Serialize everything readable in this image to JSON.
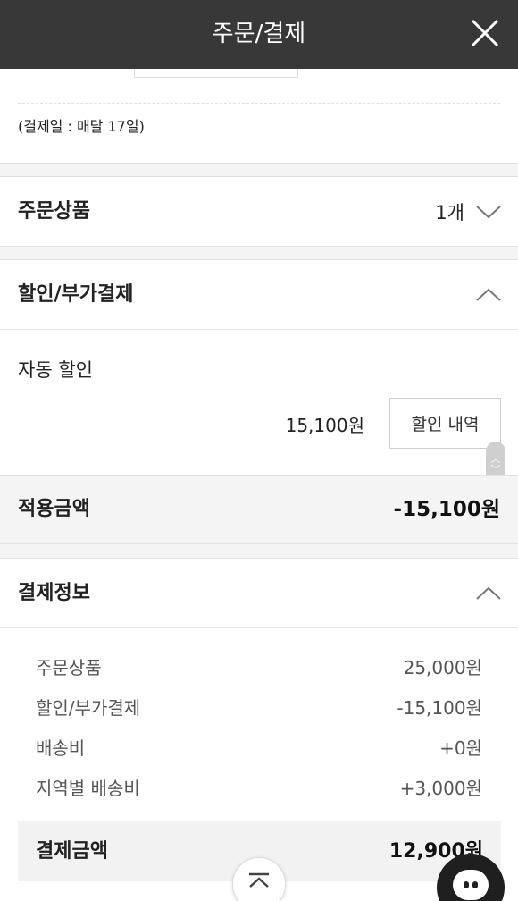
{
  "header": {
    "title": "주문/결제",
    "close_icon": "close-icon"
  },
  "payment_date": {
    "text": "(결제일 : 매달 17일)"
  },
  "order_items": {
    "title": "주문상품",
    "count": "1개",
    "toggle_icon": "chevron-down-icon"
  },
  "discount": {
    "title": "할인/부가결제",
    "toggle_icon": "chevron-up-icon",
    "auto_label": "자동 할인",
    "auto_amount": "15,100원",
    "detail_button": "할인 내역"
  },
  "applied": {
    "label": "적용금액",
    "value": "-15,100원"
  },
  "payment_info": {
    "title": "결제정보",
    "toggle_icon": "chevron-up-icon",
    "rows": [
      {
        "label": "주문상품",
        "value": "25,000원"
      },
      {
        "label": "할인/부가결제",
        "value": "-15,100원"
      },
      {
        "label": "배송비",
        "value": "+0원"
      },
      {
        "label": "지역별 배송비",
        "value": "+3,000원"
      }
    ],
    "total_label": "결제금액",
    "total_value": "12,900원"
  },
  "floating": {
    "scroll_top_icon": "arrow-up-icon",
    "chat_icon": "chat-icon"
  },
  "colors": {
    "header_bg": "#383838",
    "section_gap": "#f4f4f4",
    "chat_bg": "#1f1f1f"
  }
}
